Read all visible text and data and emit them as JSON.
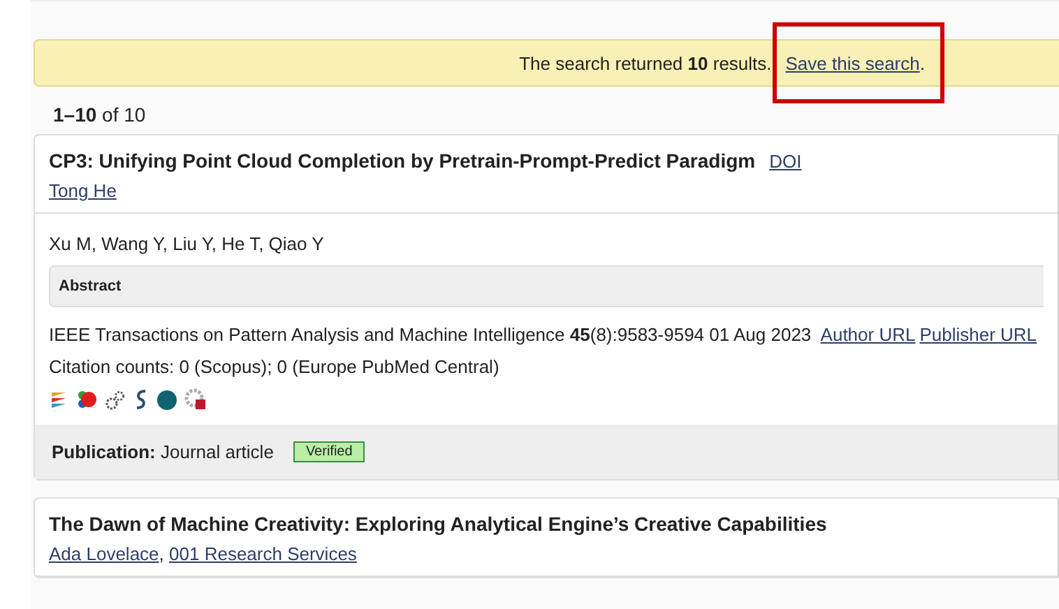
{
  "banner": {
    "message": "The search returned **10** results.",
    "link": "Save this search",
    "suffix": "."
  },
  "range": "**1–10** of 10",
  "results": [
    {
      "title": "CP3: Unifying Point Cloud Completion by Pretrain-Prompt-Predict Paradigm",
      "doi": "DOI",
      "owners": [
        "Tong He"
      ],
      "authors": "Xu M, Wang Y, Liu Y, He T, Qiao Y",
      "abstract_label": "Abstract",
      "source": "IEEE Transactions on Pattern Analysis and Machine Intelligence **45**(8):9583-9594 01 Aug 2023",
      "links": [
        "Author URL",
        "Publisher URL"
      ],
      "citations": "Citation counts: 0 (Scopus); 0 (Europe PubMed Central)",
      "type_label": "Publication:",
      "type": "Journal article",
      "status": "Verified"
    },
    {
      "title": "The Dawn of Machine Creativity: Exploring Analytical Engine’s Creative Capabilities",
      "owners": [
        "Ada Lovelace",
        "001 Research Services"
      ],
      "separator": ","
    }
  ]
}
